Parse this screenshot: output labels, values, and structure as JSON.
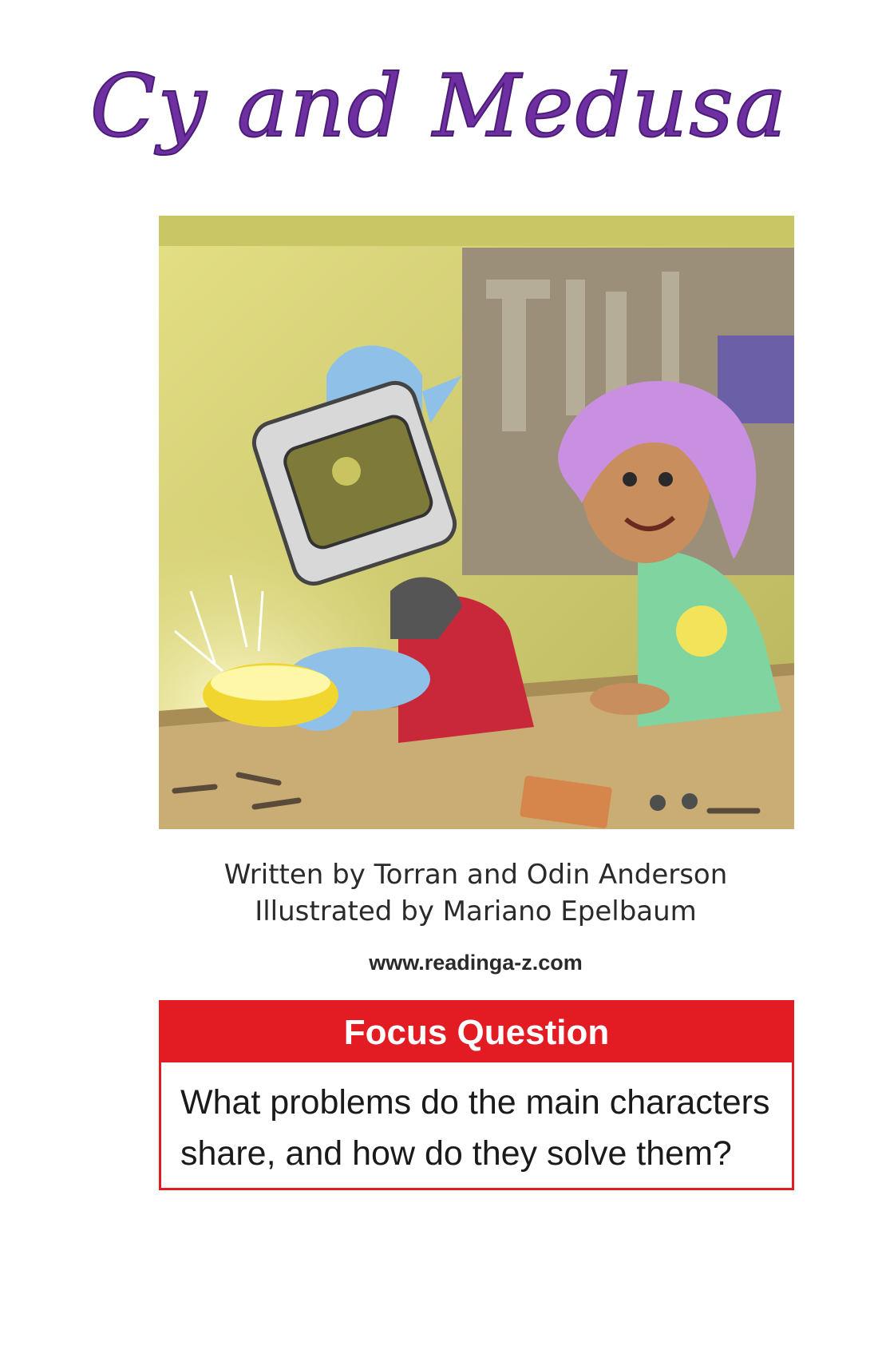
{
  "title": "Cy and Medusa",
  "illustration": {
    "characters": [
      "Cy",
      "Medusa"
    ],
    "palette": {
      "wall": "#d9d46e",
      "desk": "#c9ad74",
      "cy_skin": "#8fc0e8",
      "medusa_hair": "#c98fe0",
      "helmet": "#d8d8d8",
      "shirt_red": "#c8283a",
      "shirt_green": "#7fd4a0"
    }
  },
  "credits": {
    "written": "Written by Torran and Odin Anderson",
    "illustrated": "Illustrated by Mariano Epelbaum"
  },
  "website": "www.readinga-z.com",
  "focus": {
    "header": "Focus Question",
    "line1": "What problems do the main characters",
    "line2": "share, and how do they solve them?",
    "color": "#e31b23"
  }
}
